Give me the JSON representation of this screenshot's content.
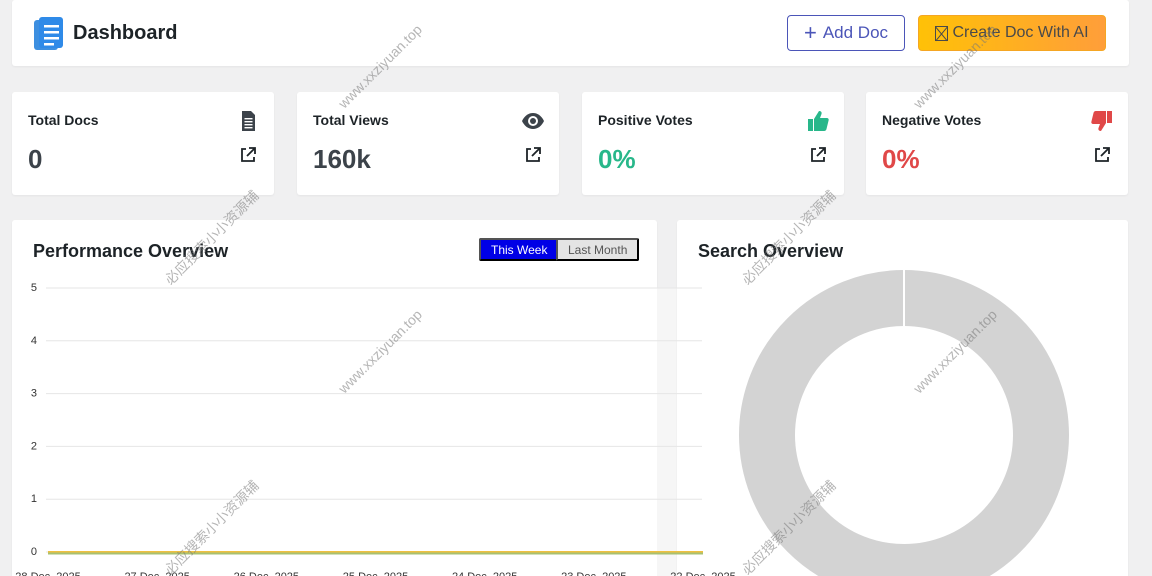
{
  "header": {
    "title": "Dashboard",
    "add_doc_label": "Add Doc",
    "create_ai_label": "Create Doc With AI",
    "logo_icon": "document-stack-icon"
  },
  "stats": [
    {
      "label": "Total Docs",
      "value": "0",
      "icon": "document-icon",
      "value_color": "#3c434a"
    },
    {
      "label": "Total Views",
      "value": "160k",
      "icon": "eye-icon",
      "value_color": "#3c434a"
    },
    {
      "label": "Positive Votes",
      "value": "0%",
      "icon": "thumbs-up-icon",
      "value_color": "#28b78a"
    },
    {
      "label": "Negative Votes",
      "value": "0%",
      "icon": "thumbs-down-icon",
      "value_color": "#e04848"
    }
  ],
  "performance": {
    "title": "Performance Overview",
    "tabs": [
      {
        "label": "This Week",
        "active": true
      },
      {
        "label": "Last Month",
        "active": false
      }
    ]
  },
  "search_overview": {
    "title": "Search Overview"
  },
  "chart_data": [
    {
      "type": "line",
      "categories": [
        "28 Dec, 2025",
        "27 Dec, 2025",
        "26 Dec, 2025",
        "25 Dec, 2025",
        "24 Dec, 2025",
        "23 Dec, 2025",
        "22 Dec, 2025"
      ],
      "series": [
        {
          "values": [
            0,
            0,
            0,
            0,
            0,
            0,
            0
          ],
          "color": "#f0c040"
        },
        {
          "values": [
            0,
            0,
            0,
            0,
            0,
            0,
            0
          ],
          "color": "#a8c070"
        }
      ],
      "yticks": [
        "0",
        "1",
        "2",
        "3",
        "4",
        "5"
      ],
      "ylim": [
        0,
        5
      ],
      "grid": true
    },
    {
      "type": "pie",
      "style": "donut",
      "values": [
        0
      ],
      "empty_color": "#d3d3d3"
    }
  ],
  "watermarks": [
    "www.xxziyuan.top",
    "必应搜索小小资源辅"
  ],
  "colors": {
    "accent": "#4b55b8",
    "ai_button": "#ffb020",
    "tab_active": "#0000e6",
    "positive": "#28b78a",
    "negative": "#e04848"
  }
}
